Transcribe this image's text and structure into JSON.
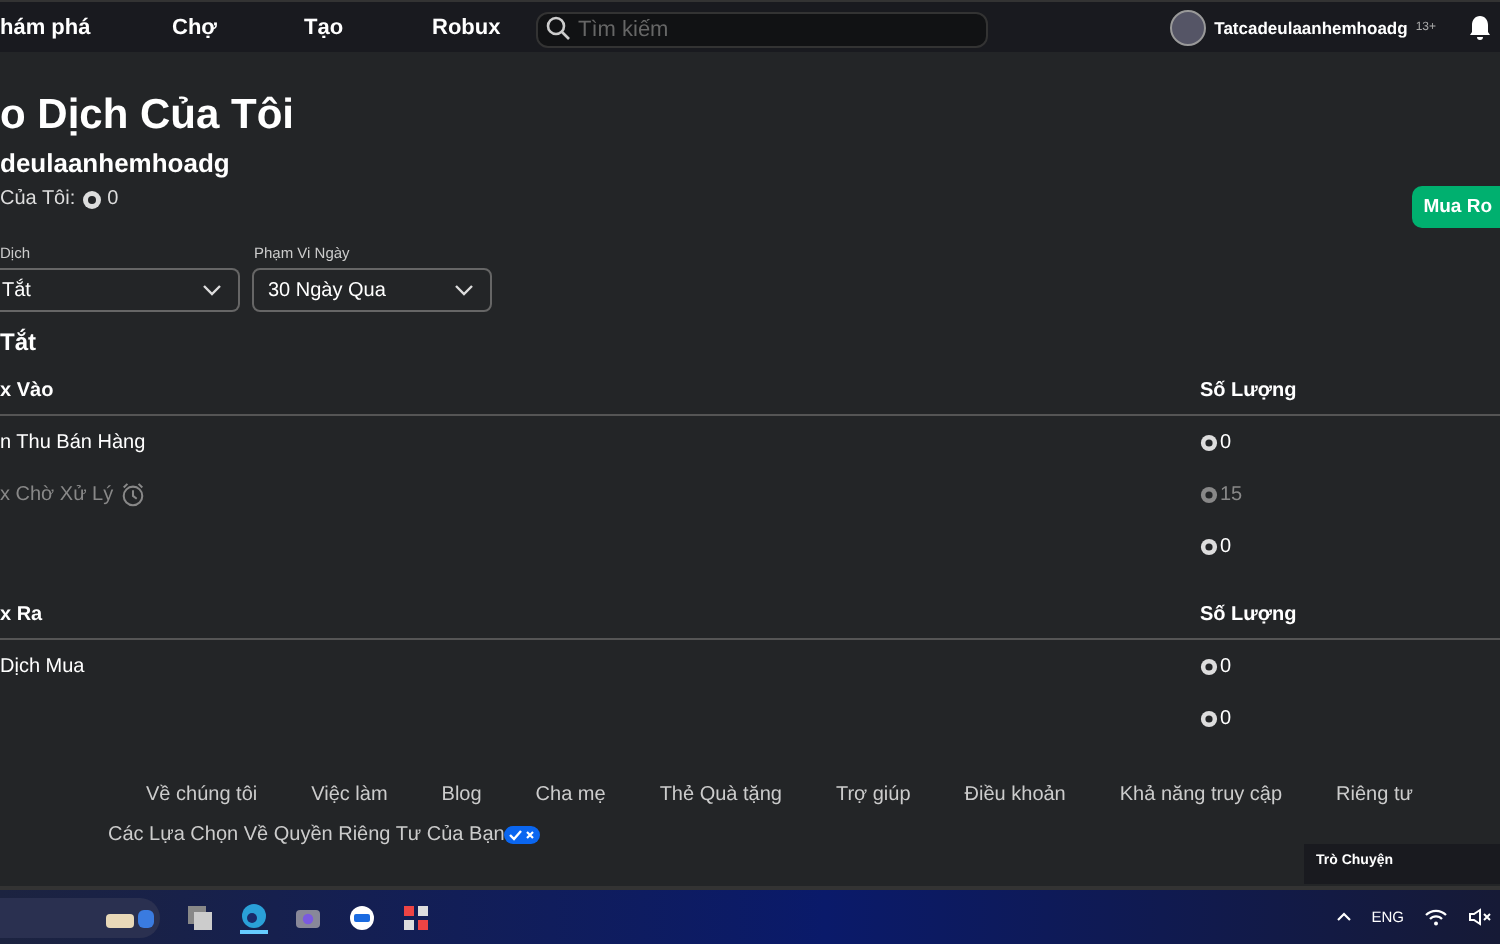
{
  "nav": {
    "items": [
      "hám phá",
      "Chợ",
      "Tạo",
      "Robux"
    ],
    "search": {
      "placeholder": "Tìm kiếm"
    },
    "username": "Tatcadeulaanhemhoadg",
    "age": "13+"
  },
  "page": {
    "title": "o Dịch Của Tôi",
    "subtitle": "deulaanhemhoadg",
    "balance_label": "Của Tôi:",
    "balance": "0",
    "buy_button": "Mua Ro"
  },
  "filters": [
    {
      "label": "Dịch",
      "value": "Tắt"
    },
    {
      "label": "Phạm Vi Ngày",
      "value": "30 Ngày Qua"
    }
  ],
  "section_title": "Tắt",
  "tables": [
    {
      "header": "x Vào",
      "amount_header": "Số Lượng",
      "rows": [
        {
          "kind": "item",
          "label": "n Thu Bán Hàng",
          "amount": "0"
        },
        {
          "kind": "pending",
          "label": "x Chờ Xử Lý",
          "amount": "15"
        },
        {
          "kind": "total",
          "amount": "0"
        }
      ]
    },
    {
      "header": "x Ra",
      "amount_header": "Số Lượng",
      "rows": [
        {
          "kind": "item",
          "label": "Dịch Mua",
          "amount": "0"
        },
        {
          "kind": "total",
          "amount": "0"
        }
      ]
    }
  ],
  "footer": {
    "links": [
      "Về chúng tôi",
      "Việc làm",
      "Blog",
      "Cha mẹ",
      "Thẻ Quà tặng",
      "Trợ giúp",
      "Điều khoản",
      "Khả năng truy cập",
      "Riêng tư"
    ],
    "privacy": "Các Lựa Chọn Về Quyền Riêng Tư Của Bạn"
  },
  "chat": {
    "label": "Trò Chuyện"
  },
  "taskbar": {
    "language": "ENG"
  }
}
